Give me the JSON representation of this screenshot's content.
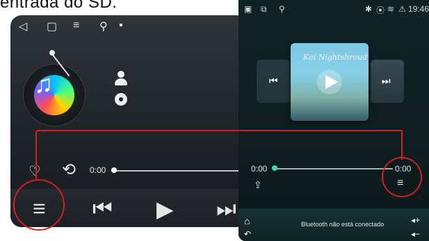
{
  "top_text": "entrada do SD.",
  "left_panel": {
    "status_icons": [
      "back-icon",
      "home-icon",
      "menu-icon",
      "usb-icon",
      "gallery-icon"
    ],
    "time_text": "0:00",
    "controls": {
      "heart": "♡",
      "repeat": "⟲",
      "list": "≡",
      "prev": "⏮",
      "play": "▶",
      "next": "⏭"
    }
  },
  "right_panel": {
    "status_time": "19:46",
    "album": {
      "title_art": "Kai Nightshroud"
    },
    "time_left": "0:00",
    "time_right": "0:00",
    "dock_text": "Bluetooth não está conectado"
  },
  "colors": {
    "callout_red": "#d21f1f",
    "accent_teal": "#33d6c2"
  }
}
